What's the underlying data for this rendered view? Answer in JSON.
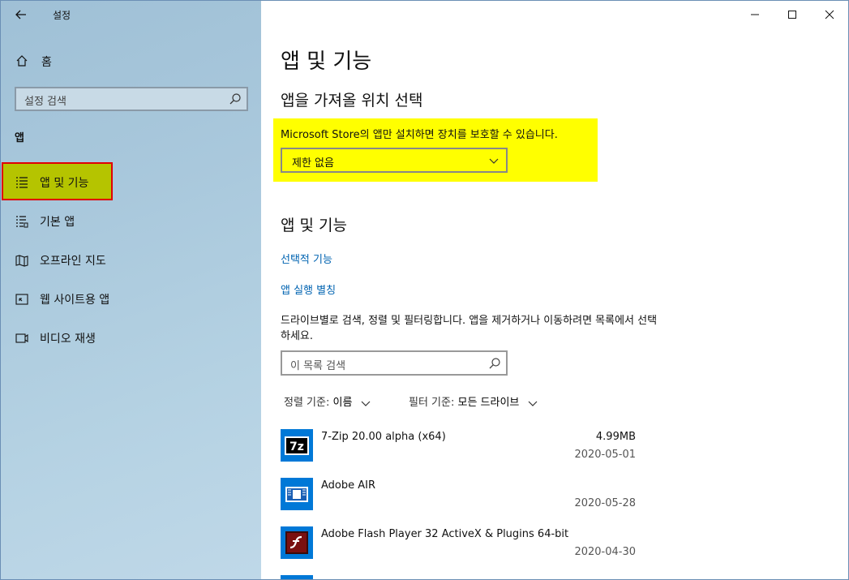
{
  "window": {
    "title": "설정",
    "controls": {
      "minimize": "minimize-icon",
      "maximize": "maximize-icon",
      "close": "close-icon"
    }
  },
  "sidebar": {
    "home_label": "홈",
    "search_placeholder": "설정 검색",
    "section_label": "앱",
    "items": [
      {
        "label": "앱 및 기능",
        "icon": "apps-features-icon",
        "selected": true
      },
      {
        "label": "기본 앱",
        "icon": "default-apps-icon",
        "selected": false
      },
      {
        "label": "오프라인 지도",
        "icon": "offline-maps-icon",
        "selected": false
      },
      {
        "label": "웹 사이트용 앱",
        "icon": "apps-for-websites-icon",
        "selected": false
      },
      {
        "label": "비디오 재생",
        "icon": "video-playback-icon",
        "selected": false
      }
    ]
  },
  "main": {
    "page_title": "앱 및 기능",
    "install_section": {
      "heading": "앱을 가져올 위치 선택",
      "note": "Microsoft Store의 앱만 설치하면 장치를 보호할 수 있습니다.",
      "dropdown_value": "제한 없음",
      "highlight_color": "#ffff00"
    },
    "apps_section": {
      "heading": "앱 및 기능",
      "link_optional": "선택적 기능",
      "link_aliases": "앱 실행 별칭",
      "description": "드라이브별로 검색, 정렬 및 필터링합니다. 앱을 제거하거나 이동하려면 목록에서 선택하세요.",
      "search_placeholder": "이 목록 검색",
      "sort_label": "정렬 기준:",
      "sort_value": "이름",
      "filter_label": "필터 기준:",
      "filter_value": "모든 드라이브"
    },
    "apps": [
      {
        "name": "7-Zip 20.00 alpha (x64)",
        "size": "4.99MB",
        "date": "2020-05-01",
        "icon": "7zip-icon"
      },
      {
        "name": "Adobe AIR",
        "size": "",
        "date": "2020-05-28",
        "icon": "adobe-air-icon"
      },
      {
        "name": "Adobe Flash Player 32 ActiveX & Plugins 64-bit",
        "size": "",
        "date": "2020-04-30",
        "icon": "flash-player-icon"
      }
    ]
  },
  "colors": {
    "accent_link": "#0063b1",
    "icon_tile": "#0078d7",
    "selection_annotation": "#e00000"
  }
}
